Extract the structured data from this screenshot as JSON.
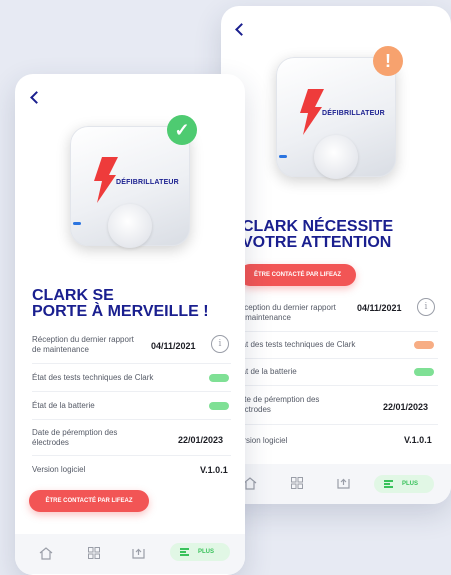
{
  "back_screen": {
    "device_label": "DÉFIBRILLATEUR",
    "status_badge": "!",
    "headline_line1": "CLARK NÉCESSITE",
    "headline_line2": "VOTRE ATTENTION",
    "contact_button": "ÊTRE CONTACTÉ PAR LIFEAZ",
    "rows": [
      {
        "label": "Réception du dernier rapport de maintenance",
        "value": "04/11/2021"
      },
      {
        "label": "État des tests techniques de Clark",
        "status": "warning"
      },
      {
        "label": "État de la batterie",
        "status": "ok"
      },
      {
        "label": "Date de péremption des électrodes",
        "value": "22/01/2023"
      },
      {
        "label": "Version logiciel",
        "value": "V.1.0.1"
      }
    ],
    "nav_more": "PLUS"
  },
  "front_screen": {
    "device_label": "DÉFIBRILLATEUR",
    "status_badge": "✓",
    "headline_line1": "CLARK SE",
    "headline_line2": "PORTE À MERVEILLE !",
    "rows": [
      {
        "label": "Réception du dernier rapport de maintenance",
        "value": "04/11/2021"
      },
      {
        "label": "État des tests techniques de Clark",
        "status": "ok"
      },
      {
        "label": "État de la batterie",
        "status": "ok"
      },
      {
        "label": "Date de péremption des électrodes",
        "value": "22/01/2023"
      },
      {
        "label": "Version logiciel",
        "value": "V.1.0.1"
      }
    ],
    "contact_button": "ÊTRE CONTACTÉ PAR LIFEAZ",
    "nav_more": "PLUS"
  },
  "icons": {
    "back": "chevron-left-icon",
    "home": "home-icon",
    "grid": "grid-icon",
    "document": "document-arrow-icon",
    "menu": "menu-lines-icon",
    "info": "info-icon",
    "bolt": "lightning-bolt-icon"
  },
  "colors": {
    "navy": "#1a1f8f",
    "accent_red": "#f25555",
    "ok_green": "#7fe095",
    "warn_orange": "#f7ad84"
  }
}
